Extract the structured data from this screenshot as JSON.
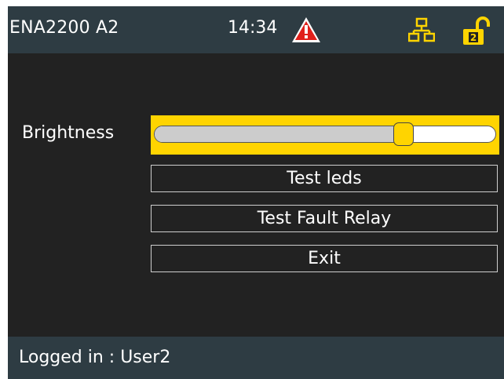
{
  "header": {
    "device_name": "ENA2200 A2",
    "time": "14:34",
    "icons": [
      "warning-icon",
      "network-icon",
      "unlocked-padlock-icon"
    ],
    "lock_level": "2"
  },
  "settings": {
    "brightness_label": "Brightness",
    "brightness_level": 0.73,
    "buttons": {
      "test_leds": "Test leds",
      "test_fault_relay": "Test Fault Relay",
      "exit": "Exit"
    }
  },
  "footer": {
    "status": "Logged in : User2"
  },
  "colors": {
    "accent": "#ffd400",
    "background": "#222222",
    "bar": "#2e3c43",
    "warning": "#e0201b"
  }
}
